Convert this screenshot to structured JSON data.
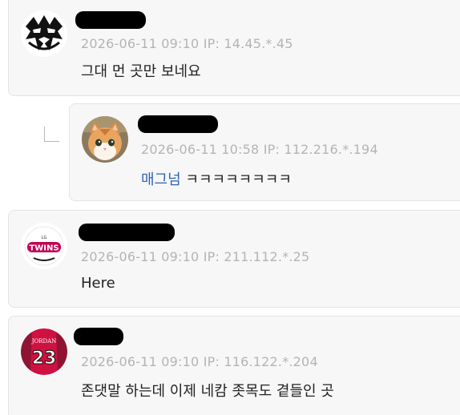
{
  "comments": [
    {
      "timestamp": "2026-06-11 09:10",
      "ip_label": "IP:",
      "ip": "14.45.*.45",
      "text": "그대 먼 곳만 보네요",
      "avatar_icon": "wrestler-mask-icon"
    },
    {
      "timestamp": "2026-06-11 10:58",
      "ip_label": "IP:",
      "ip": "112.216.*.194",
      "mention": "매그넘",
      "text": " ㅋㅋㅋㅋㅋㅋㅋㅋ",
      "avatar_icon": "kitten-photo-icon"
    },
    {
      "timestamp": "2026-06-11 09:10",
      "ip_label": "IP:",
      "ip": "211.112.*.25",
      "text": "Here",
      "avatar_icon": "lg-twins-logo-icon",
      "logo_text": "TWINS",
      "logo_sub": "LG"
    },
    {
      "timestamp": "2026-06-11 09:10",
      "ip_label": "IP:",
      "ip": "116.122.*.204",
      "text": "존댓말 하는데 이제 네캄 좃목도 곁들인 곳",
      "avatar_icon": "jordan-jersey-icon",
      "logo_text": "23",
      "logo_sub": "JORDAN"
    }
  ],
  "colors": {
    "card_bg": "#f7f7f7",
    "meta": "#b4b4b4",
    "mention": "#2f62b6",
    "twins_red": "#c30452",
    "jersey_red": "#ce1141"
  }
}
